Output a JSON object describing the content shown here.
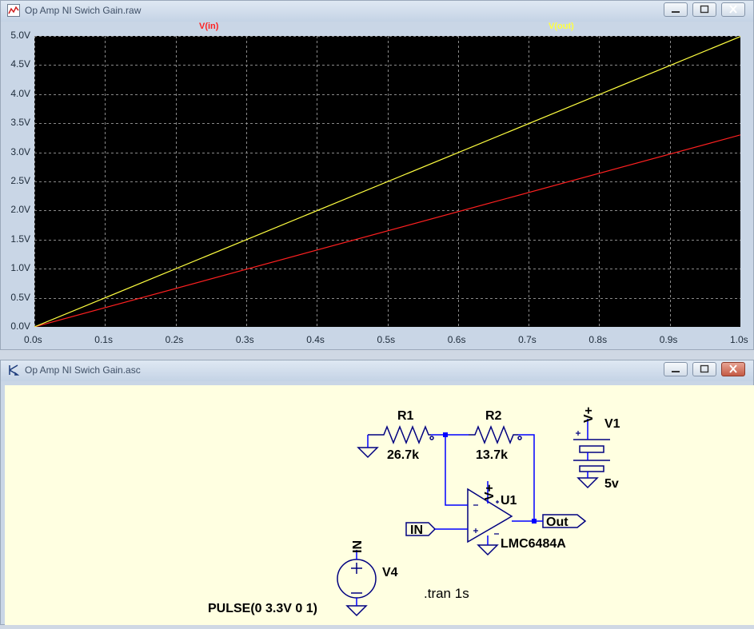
{
  "plot_window": {
    "title": "Op Amp NI Swich Gain.raw",
    "icon": "waveform-icon",
    "controls": [
      "minimize-icon",
      "maximize-icon",
      "close-icon"
    ]
  },
  "schematic_window": {
    "title": "Op Amp NI Swich Gain.asc",
    "icon": "schematic-icon",
    "controls": [
      "minimize-icon",
      "maximize-icon",
      "close-icon"
    ]
  },
  "chart_data": {
    "type": "line",
    "x_ticks": [
      "0.0s",
      "0.1s",
      "0.2s",
      "0.3s",
      "0.4s",
      "0.5s",
      "0.6s",
      "0.7s",
      "0.8s",
      "0.9s",
      "1.0s"
    ],
    "y_ticks": [
      "0.0V",
      "0.5V",
      "1.0V",
      "1.5V",
      "2.0V",
      "2.5V",
      "3.0V",
      "3.5V",
      "4.0V",
      "4.5V",
      "5.0V"
    ],
    "xlim": [
      0,
      1.0
    ],
    "ylim": [
      0,
      5.0
    ],
    "grid": true,
    "background": "#000000",
    "series": [
      {
        "name": "V(in)",
        "color": "#ff2020",
        "x": [
          0,
          1.0
        ],
        "y": [
          0,
          3.3
        ]
      },
      {
        "name": "V(out)",
        "color": "#ffff40",
        "x": [
          0,
          1.0
        ],
        "y": [
          0,
          4.99
        ]
      }
    ]
  },
  "schematic": {
    "r1": {
      "name": "R1",
      "value": "26.7k"
    },
    "r2": {
      "name": "R2",
      "value": "13.7k"
    },
    "v1": {
      "name": "V1",
      "value": "5v",
      "net": "V+"
    },
    "u1": {
      "name": "U1",
      "part": "LMC6484A",
      "supply": "V+"
    },
    "in_label": "IN",
    "out_label": "Out",
    "v4": {
      "name": "V4",
      "net": "IN",
      "value": "PULSE(0 3.3V 0 1)"
    },
    "directive": ".tran 1s"
  },
  "colors": {
    "wire": "#0000ff",
    "symbol": "#000080",
    "schematic_bg": "#ffffe1",
    "grid": "#8a8a8a"
  }
}
